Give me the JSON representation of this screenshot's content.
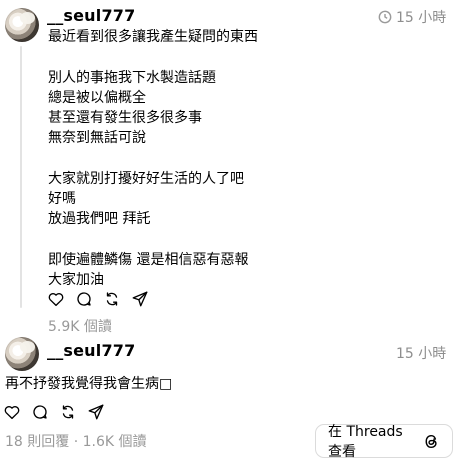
{
  "post": {
    "username": "__seul777",
    "timestamp": "15 小時",
    "lines": [
      "最近看到很多讓我產生疑問的東西",
      "",
      "別人的事拖我下水製造話題",
      "總是被以偏概全",
      "甚至還有發生很多很多事",
      "無奈到無話可說",
      "",
      "大家就別打擾好好生活的人了吧",
      "好嗎",
      "放過我們吧 拜託",
      "",
      "即使遍體鱗傷 還是相信惡有惡報",
      "大家加油"
    ],
    "views": "5.9K 個讀"
  },
  "reply": {
    "username": "__seul777",
    "timestamp": "15 小時",
    "text": "再不抒發我覺得我會生病□",
    "stats": "18 則回覆 · 1.6K 個讀"
  },
  "footer": {
    "open_in_threads_label": "在 Threads 查看"
  },
  "icons": {
    "like": "heart-icon",
    "comment": "comment-icon",
    "repost": "repost-icon",
    "share": "share-icon",
    "threads": "threads-logo-icon",
    "edited": "edited-icon"
  }
}
